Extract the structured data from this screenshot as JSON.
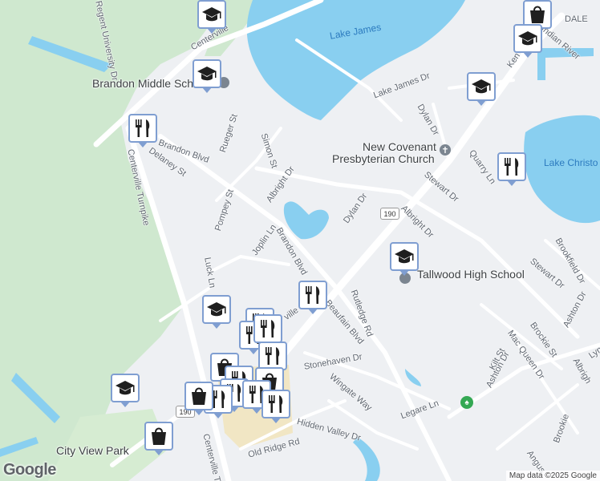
{
  "map": {
    "labels": {
      "lake_james": "Lake James",
      "lake_christopher": "Lake Christo",
      "brandon_middle": "Brandon Middle Sch",
      "new_covenant_1": "New Covenant",
      "new_covenant_2": "Presbyterian Church",
      "tallwood": "Tallwood High School",
      "city_view_park": "City View Park",
      "regent": "Regent University Dr",
      "centerville_top": "Centerville",
      "centerville_tpke": "Centerville Turnpike",
      "centerville_tpke_s": "Centerville Turnpi",
      "brandon_blvd_w": "Brandon Blvd",
      "brandon_blvd_s": "Brandon Blvd",
      "delaney": "Delaney St",
      "rueger": "Rueger St",
      "simon": "Simon St",
      "albright_w": "Albright Dr",
      "albright_e": "Albright Dr",
      "pompey": "Pompey St",
      "joplin": "Joplin Ln",
      "luck": "Luck Ln",
      "dylan_n": "Dylan Dr",
      "dylan_s": "Dylan Dr",
      "lake_james_dr": "Lake James Dr",
      "stewart_n": "Stewart Dr",
      "stewart_s": "Stewart Dr",
      "quarry": "Quarry Ln",
      "brookfield": "Brookfield Dr",
      "ashton_e": "Ashton Dr",
      "ashton_s": "Ashton Dr",
      "mac_queen": "Mac Queen Dr",
      "brockie": "Brockie St",
      "kilt": "Kilt St",
      "rutledge": "Rutledge Rd",
      "beaufain": "Beaufain Blvd",
      "stonehaven": "Stonehaven Dr",
      "wingate": "Wingate Way",
      "legare": "Legare Ln",
      "hidden_valley": "Hidden Valley Dr",
      "old_ridge": "Old Ridge Rd",
      "angus": "Angus",
      "indian_river": "Indian River",
      "lyn": "Lyn",
      "albright_se": "Albrigh",
      "ken": "Ken",
      "brookie": "Brookie",
      "ville": "ville",
      "dale": "DALE",
      "shield_190_a": "190",
      "shield_190_b": "190"
    },
    "google_logo": "Google",
    "attribution": "Map data ©2025 Google",
    "colors": {
      "water": "#89cff0",
      "park": "#c8e6c9",
      "road": "#ffffff",
      "pin_border": "#7f9ed1",
      "pin_icon": "#1f1f1f"
    },
    "pins": [
      {
        "type": "school"
      },
      {
        "type": "shopping"
      },
      {
        "type": "school"
      },
      {
        "type": "school"
      },
      {
        "type": "school"
      },
      {
        "type": "restaurant"
      },
      {
        "type": "restaurant"
      },
      {
        "type": "school"
      },
      {
        "type": "restaurant"
      },
      {
        "type": "school"
      },
      {
        "type": "restaurant"
      },
      {
        "type": "restaurant"
      },
      {
        "type": "restaurant"
      },
      {
        "type": "restaurant"
      },
      {
        "type": "school"
      },
      {
        "type": "shopping"
      },
      {
        "type": "restaurant"
      },
      {
        "type": "shopping"
      },
      {
        "type": "restaurant"
      },
      {
        "type": "restaurant"
      },
      {
        "type": "shopping"
      },
      {
        "type": "restaurant"
      },
      {
        "type": "restaurant"
      },
      {
        "type": "shopping"
      }
    ]
  }
}
